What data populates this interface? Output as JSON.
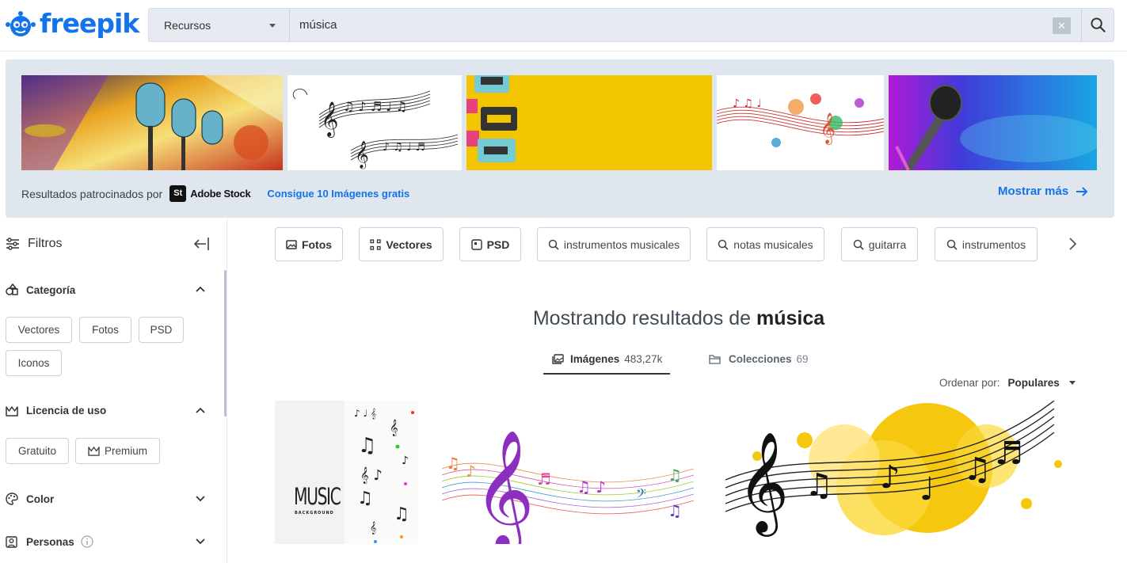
{
  "brand": {
    "name": "freepik",
    "color": "#1273eb"
  },
  "search": {
    "resource_type": "Recursos",
    "query": "música",
    "clear_icon": "close-icon",
    "submit_icon": "search-icon"
  },
  "banner": {
    "sponsored_label": "Resultados patrocinados por",
    "sponsor_logo": "St",
    "sponsor_name": "Adobe Stock",
    "free_offer": "Consigue 10 Imágenes gratis",
    "show_more": "Mostrar más",
    "images": [
      "microphones-concert-photo",
      "music-notes-staff-drawing",
      "cassette-tapes-on-yellow",
      "colorful-music-notes-splash",
      "microphone-blue-pink-light"
    ]
  },
  "sidebar": {
    "title": "Filtros",
    "sections": [
      {
        "label": "Categoría",
        "expanded": true,
        "options": [
          "Vectores",
          "Fotos",
          "PSD",
          "Iconos"
        ]
      },
      {
        "label": "Licencia de uso",
        "expanded": true,
        "options": [
          "Gratuito",
          "Premium"
        ]
      },
      {
        "label": "Color",
        "expanded": false
      },
      {
        "label": "Personas",
        "expanded": false
      }
    ]
  },
  "tags": [
    {
      "label": "Fotos",
      "icon": "image-icon"
    },
    {
      "label": "Vectores",
      "icon": "vector-icon"
    },
    {
      "label": "PSD",
      "icon": "psd-icon"
    },
    {
      "label": "instrumentos musicales",
      "icon": "search-icon"
    },
    {
      "label": "notas musicales",
      "icon": "search-icon"
    },
    {
      "label": "guitarra",
      "icon": "search-icon"
    },
    {
      "label": "instrumentos",
      "icon": "search-icon"
    }
  ],
  "results": {
    "heading_prefix": "Mostrando resultados de",
    "heading_query": "música",
    "tabs": [
      {
        "label": "Imágenes",
        "count": "483,27k",
        "active": true
      },
      {
        "label": "Colecciones",
        "count": "69",
        "active": false
      }
    ],
    "sort_label": "Ordenar por:",
    "sort_value": "Populares",
    "thumb1_text": "MUSIC",
    "thumb1_sub": "BACKGROUND"
  }
}
